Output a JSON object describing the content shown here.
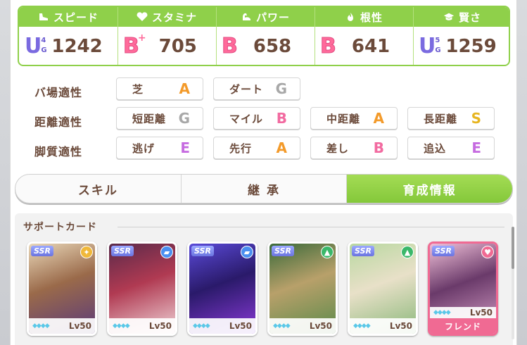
{
  "stats": [
    {
      "name": "スピード",
      "icon": "shoe-icon",
      "rank": "U",
      "rank_sub_top": "4",
      "rank_sub_bottom": "G",
      "value": "1242"
    },
    {
      "name": "スタミナ",
      "icon": "heart-icon",
      "rank": "B",
      "rank_plus": "+",
      "value": "705"
    },
    {
      "name": "パワー",
      "icon": "muscle-icon",
      "rank": "B",
      "value": "658"
    },
    {
      "name": "根性",
      "icon": "flame-icon",
      "rank": "B",
      "value": "641"
    },
    {
      "name": "賢さ",
      "icon": "graduation-cap-icon",
      "rank": "U",
      "rank_sub_top": "5",
      "rank_sub_bottom": "G",
      "value": "1259"
    }
  ],
  "aptitude": {
    "track_label": "バ場適性",
    "distance_label": "距離適性",
    "style_label": "脚質適性",
    "track": [
      {
        "name": "芝",
        "grade": "A"
      },
      {
        "name": "ダート",
        "grade": "G"
      }
    ],
    "distance": [
      {
        "name": "短距離",
        "grade": "G"
      },
      {
        "name": "マイル",
        "grade": "B"
      },
      {
        "name": "中距離",
        "grade": "A"
      },
      {
        "name": "長距離",
        "grade": "S"
      }
    ],
    "style": [
      {
        "name": "逃げ",
        "grade": "E"
      },
      {
        "name": "先行",
        "grade": "A"
      },
      {
        "name": "差し",
        "grade": "B"
      },
      {
        "name": "追込",
        "grade": "E"
      }
    ]
  },
  "tabs": [
    {
      "label": "スキル"
    },
    {
      "label": "継 承"
    },
    {
      "label": "育成情報"
    }
  ],
  "support": {
    "title": "サポートカード",
    "cards": [
      {
        "rarity": "SSR",
        "type_icon": "friend-gold-icon",
        "level": "Lv50"
      },
      {
        "rarity": "SSR",
        "type_icon": "speed-shoe-icon",
        "level": "Lv50"
      },
      {
        "rarity": "SSR",
        "type_icon": "speed-shoe-icon",
        "level": "Lv50"
      },
      {
        "rarity": "SSR",
        "type_icon": "wisdom-cap-icon",
        "level": "Lv50"
      },
      {
        "rarity": "SSR",
        "type_icon": "wisdom-cap-icon",
        "level": "Lv50"
      },
      {
        "rarity": "SSR",
        "type_icon": "heart-icon",
        "level": "Lv50",
        "friend_label": "フレンド"
      }
    ]
  },
  "colors": {
    "accent_green": "#8fd04a",
    "text_brown": "#6b4a3a",
    "rank_b": "#ff6a9a",
    "rank_u": "#7a6ae0"
  }
}
